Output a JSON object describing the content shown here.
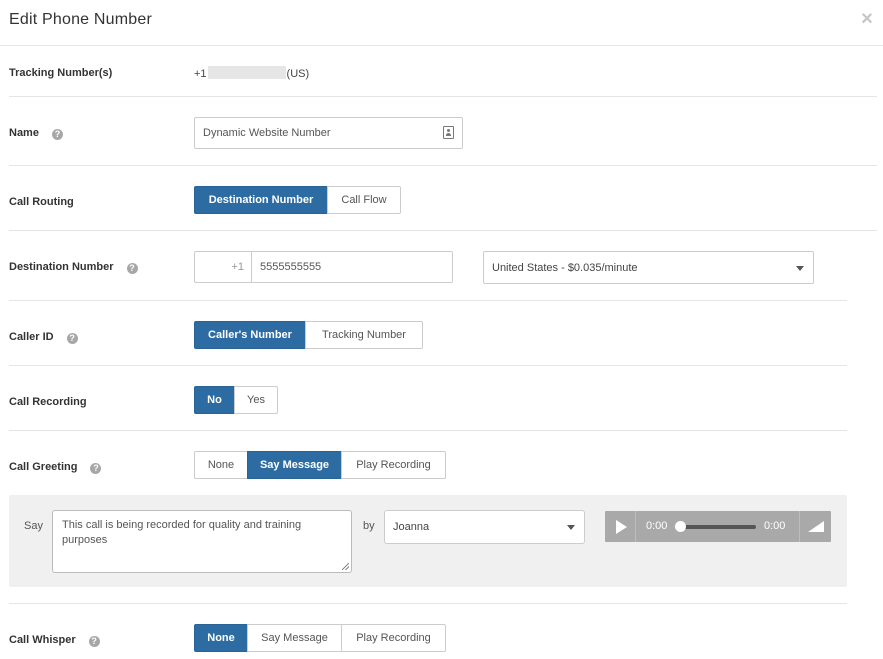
{
  "modal": {
    "title": "Edit Phone Number",
    "close_glyph": "×"
  },
  "tracking": {
    "label": "Tracking Number(s)",
    "prefix": "+1",
    "suffix": "(US)"
  },
  "name": {
    "label": "Name",
    "value": "Dynamic Website Number",
    "help_glyph": "?"
  },
  "call_routing": {
    "label": "Call Routing",
    "options": [
      "Destination Number",
      "Call Flow"
    ],
    "selected": "Destination Number"
  },
  "destination_number": {
    "label": "Destination Number",
    "help_glyph": "?",
    "country_code": "+1",
    "number": "5555555555",
    "rate_select": "United States - $0.035/minute"
  },
  "caller_id": {
    "label": "Caller ID",
    "help_glyph": "?",
    "options": [
      "Caller's Number",
      "Tracking Number"
    ],
    "selected": "Caller's Number"
  },
  "call_recording": {
    "label": "Call Recording",
    "options": [
      "No",
      "Yes"
    ],
    "selected": "No"
  },
  "call_greeting": {
    "label": "Call Greeting",
    "help_glyph": "?",
    "options": [
      "None",
      "Say Message",
      "Play Recording"
    ],
    "selected": "Say Message",
    "say_label": "Say",
    "message": "This call is being recorded for quality and training purposes",
    "by_label": "by",
    "voice": "Joanna",
    "audio": {
      "current_time": "0:00",
      "duration": "0:00",
      "progress": 0
    }
  },
  "call_whisper": {
    "label": "Call Whisper",
    "help_glyph": "?",
    "options": [
      "None",
      "Say Message",
      "Play Recording"
    ],
    "selected": "None"
  },
  "icons": {
    "help": "question-circle-icon",
    "contact": "contact-card-icon",
    "close": "close-icon",
    "caret": "chevron-down-icon",
    "play": "play-icon",
    "volume": "volume-icon"
  },
  "colors": {
    "accent": "#2d6ca2",
    "panel_bg": "#f0f0f0",
    "help_icon": "#a7a7a7"
  }
}
